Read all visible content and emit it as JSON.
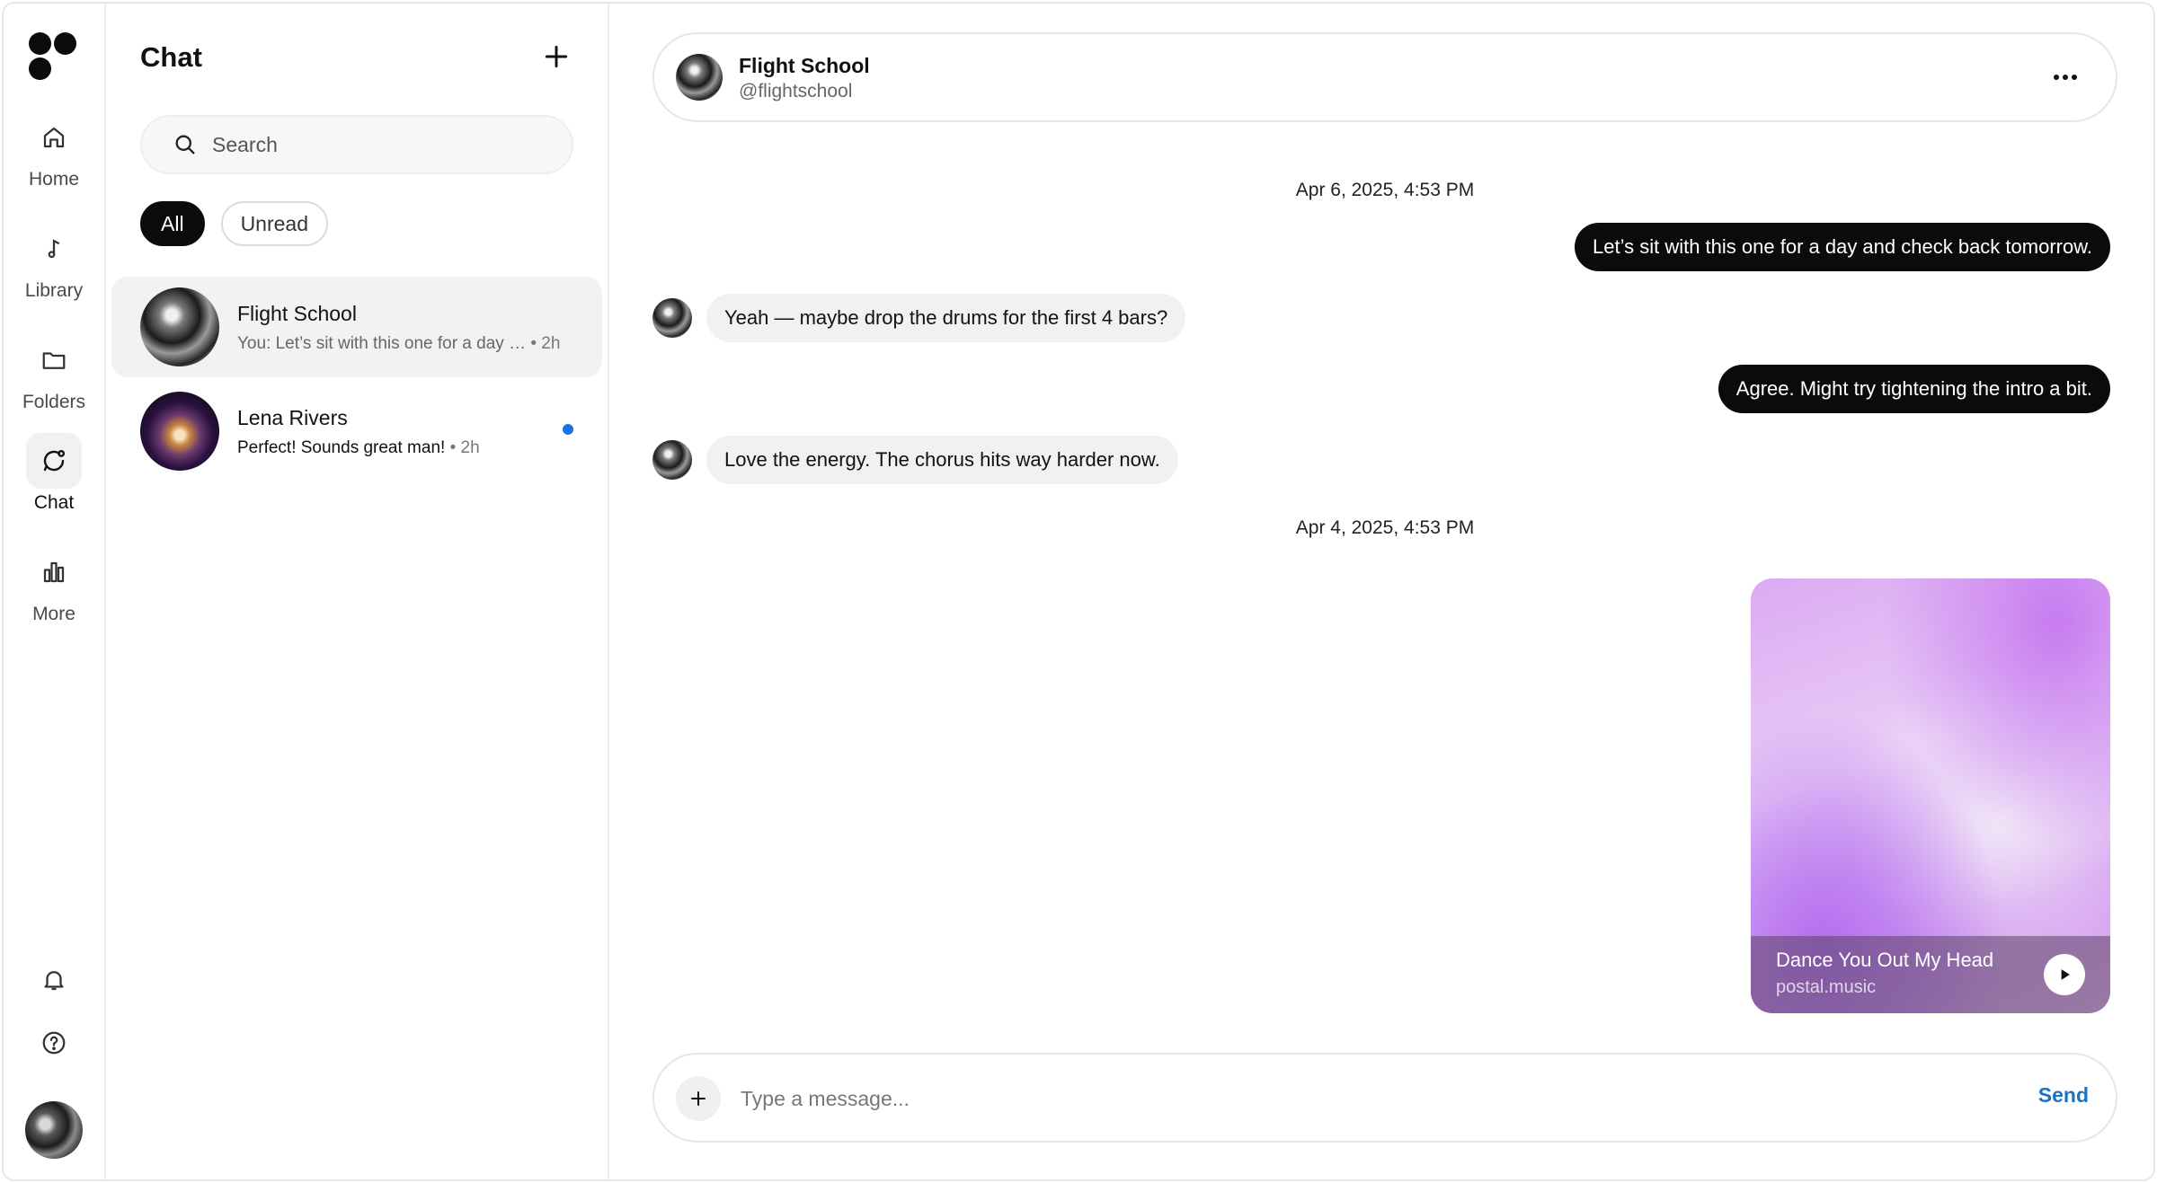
{
  "rail": {
    "items": [
      {
        "label": "Home",
        "icon": "home-icon"
      },
      {
        "label": "Library",
        "icon": "music-note-icon"
      },
      {
        "label": "Folders",
        "icon": "folder-icon"
      },
      {
        "label": "Chat",
        "icon": "chat-icon",
        "active": true
      },
      {
        "label": "More",
        "icon": "bar-chart-icon"
      }
    ]
  },
  "list": {
    "title": "Chat",
    "search_placeholder": "Search",
    "filters": [
      "All",
      "Unread"
    ],
    "active_filter": "All",
    "conversations": [
      {
        "name": "Flight School",
        "preview": "You: Let’s sit with this one for a day …",
        "time": "• 2h",
        "selected": true,
        "unread": false
      },
      {
        "name": "Lena Rivers",
        "preview": "Perfect! Sounds great man!",
        "time": "• 2h",
        "selected": false,
        "unread": true
      }
    ]
  },
  "conversation": {
    "name": "Flight School",
    "handle": "@flightschool",
    "timestamps": [
      "Apr 6, 2025, 4:53 PM",
      "Apr 4, 2025, 4:53 PM"
    ],
    "messages": [
      {
        "direction": "out",
        "text": "Let’s sit with this one for a day and check back tomorrow."
      },
      {
        "direction": "in",
        "text": "Yeah — maybe drop the drums for the first 4 bars?"
      },
      {
        "direction": "out",
        "text": "Agree. Might try tightening the intro a bit."
      },
      {
        "direction": "in",
        "text": "Love the energy. The chorus hits way harder now."
      }
    ],
    "shared_track": {
      "title": "Dance You Out My Head",
      "source": "postal.music"
    }
  },
  "composer": {
    "placeholder": "Type a message...",
    "send_label": "Send"
  },
  "colors": {
    "accent": "#1a73c4",
    "unread_dot": "#1a73e8",
    "outgoing_bubble": "#0b0b0b",
    "incoming_bubble": "#f1f1f3"
  }
}
